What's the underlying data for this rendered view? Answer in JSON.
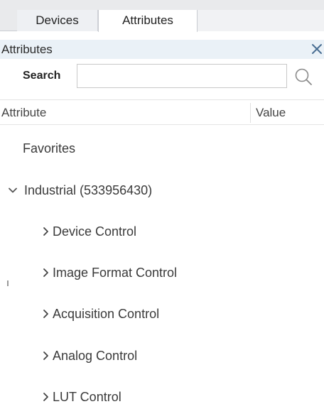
{
  "tabs": [
    {
      "label": "Devices",
      "active": false
    },
    {
      "label": "Attributes",
      "active": true
    }
  ],
  "panel": {
    "title": "Attributes"
  },
  "search": {
    "label": "Search",
    "value": "",
    "placeholder": ""
  },
  "columns": {
    "attribute": "Attribute",
    "value": "Value"
  },
  "tree": {
    "favorites": {
      "label": "Favorites"
    },
    "industrial": {
      "label": "Industrial (533956430)",
      "expanded": true
    },
    "children": [
      {
        "label": "Device Control",
        "expanded": false
      },
      {
        "label": "Image Format Control",
        "expanded": false
      },
      {
        "label": "Acquisition Control",
        "expanded": false
      },
      {
        "label": "Analog Control",
        "expanded": false
      },
      {
        "label": "LUT Control",
        "expanded": false
      }
    ]
  },
  "icons": {
    "close": "close-icon",
    "search": "search-icon",
    "expanded": "chevron-down-icon",
    "collapsed": "chevron-right-icon"
  },
  "colors": {
    "accent": "#4a6f93",
    "header_bg": "#eaf1f7"
  }
}
